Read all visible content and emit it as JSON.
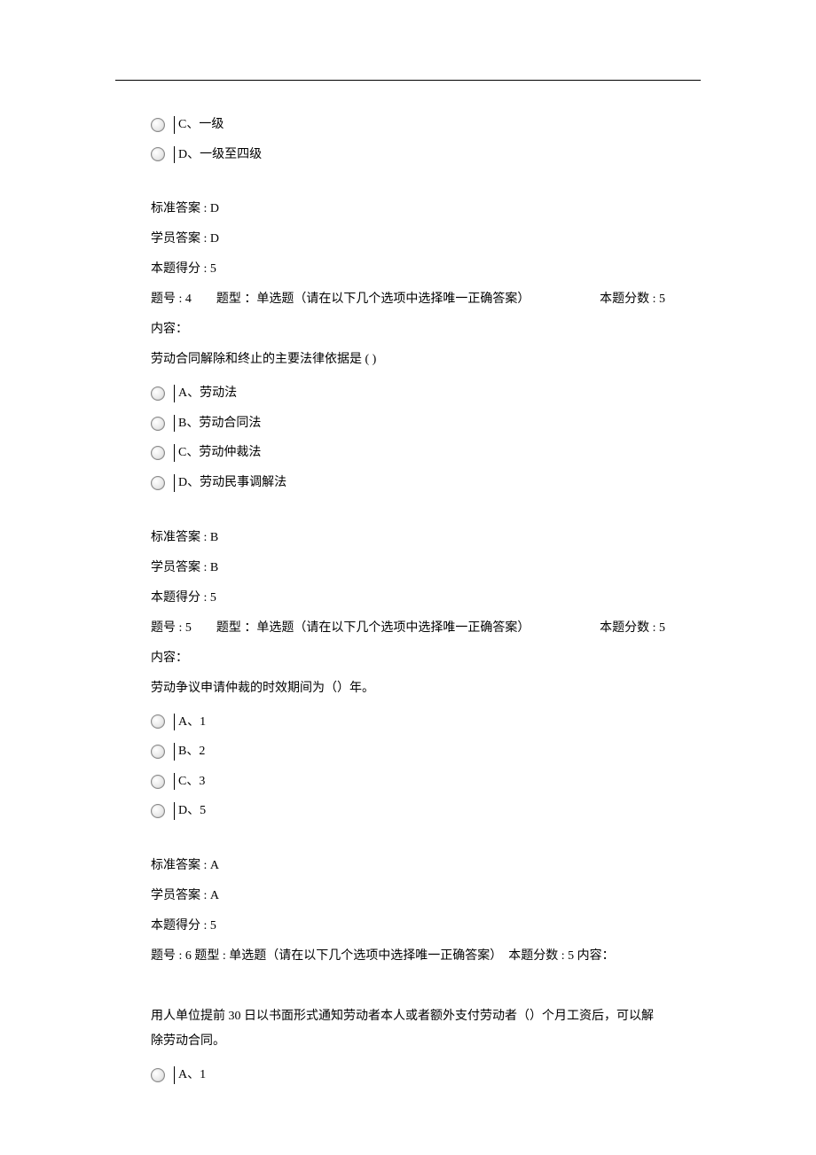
{
  "q3": {
    "option_c": "C、一级",
    "option_d": "D、一级至四级",
    "std_answer": "标准答案 : D",
    "stu_answer": "学员答案 : D",
    "score": "本题得分 : 5"
  },
  "q4": {
    "header_left": "题号 : 4　　题型 ：单选题（请在以下几个选项中选择唯一正确答案）",
    "header_right": "本题分数 : 5",
    "content_label": "内容：",
    "content_text": "劳动合同解除和终止的主要法律依据是 ( )",
    "option_a": "A、劳动法",
    "option_b": "B、劳动合同法",
    "option_c": "C、劳动仲裁法",
    "option_d": "D、劳动民事调解法",
    "std_answer": "标准答案 : B",
    "stu_answer": "学员答案 : B",
    "score": "本题得分 : 5"
  },
  "q5": {
    "header_left": "题号 : 5　　题型 ：单选题（请在以下几个选项中选择唯一正确答案）",
    "header_right": "本题分数 : 5",
    "content_label": "内容：",
    "content_text": "劳动争议申请仲裁的时效期间为（）年。",
    "option_a": "A、1",
    "option_b": "B、2",
    "option_c": "C、3",
    "option_d": "D、5",
    "std_answer": "标准答案 : A",
    "stu_answer": "学员答案 : A",
    "score": "本题得分 : 5"
  },
  "q6": {
    "header_line": "题号 : 6 题型 : 单选题（请在以下几个选项中选择唯一正确答案）　本题分数 : 5 内容：",
    "content_text": "用人单位提前 30 日以书面形式通知劳动者本人或者额外支付劳动者（）个月工资后，可以解除劳动合同。",
    "option_a": "A、1"
  }
}
